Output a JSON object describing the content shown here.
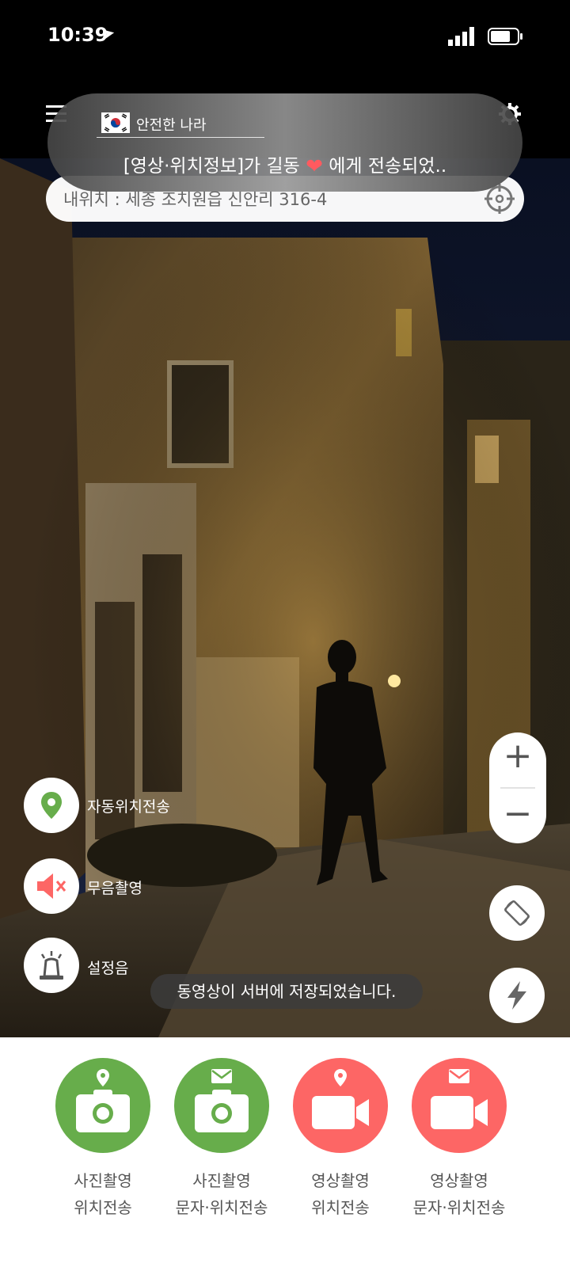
{
  "status_bar": {
    "time": "10:39"
  },
  "location": {
    "text": "내위치 : 세종 조치원읍 신안리 316-4"
  },
  "notification": {
    "app_name": "안전한 나라",
    "message_before": "[영상·위치정보]가 길동",
    "message_after": "에게 전송되었.."
  },
  "side_controls": {
    "auto_location": "자동위치전송",
    "silent_capture": "무음촬영",
    "alarm_sound": "설정음"
  },
  "zoom": {
    "plus": "+",
    "minus": "−"
  },
  "toast": "동영상이 서버에 저장되었습니다.",
  "actions": [
    {
      "line1": "사진촬영",
      "line2": "위치전송",
      "icon": "camera-location",
      "color": "#67ad4b"
    },
    {
      "line1": "사진촬영",
      "line2": "문자·위치전송",
      "icon": "camera-mail",
      "color": "#67ad4b"
    },
    {
      "line1": "영상촬영",
      "line2": "위치전송",
      "icon": "video-location",
      "color": "#fd6665"
    },
    {
      "line1": "영상촬영",
      "line2": "문자·위치전송",
      "icon": "video-mail",
      "color": "#fd6665"
    }
  ]
}
